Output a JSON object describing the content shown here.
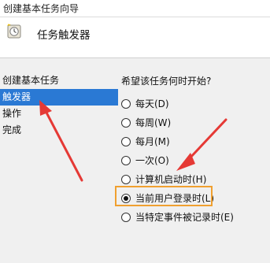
{
  "window": {
    "title": "创建基本任务向导"
  },
  "header": {
    "title": "任务触发器",
    "icon": "clock-icon"
  },
  "sidebar": {
    "items": [
      {
        "label": "创建基本任务",
        "selected": false
      },
      {
        "label": "触发器",
        "selected": true
      },
      {
        "label": "操作",
        "selected": false
      },
      {
        "label": "完成",
        "selected": false
      }
    ]
  },
  "main": {
    "question": "希望该任务何时开始?",
    "options": [
      {
        "label": "每天(D)",
        "checked": false
      },
      {
        "label": "每周(W)",
        "checked": false
      },
      {
        "label": "每月(M)",
        "checked": false
      },
      {
        "label": "一次(O)",
        "checked": false
      },
      {
        "label": "计算机启动时(H)",
        "checked": false
      },
      {
        "label": "当前用户登录时(L)",
        "checked": true
      },
      {
        "label": "当特定事件被记录时(E)",
        "checked": false
      }
    ]
  },
  "colors": {
    "selection": "#2a79d4",
    "highlight_box": "#f0a030",
    "annotation_arrow": "#e53935"
  }
}
